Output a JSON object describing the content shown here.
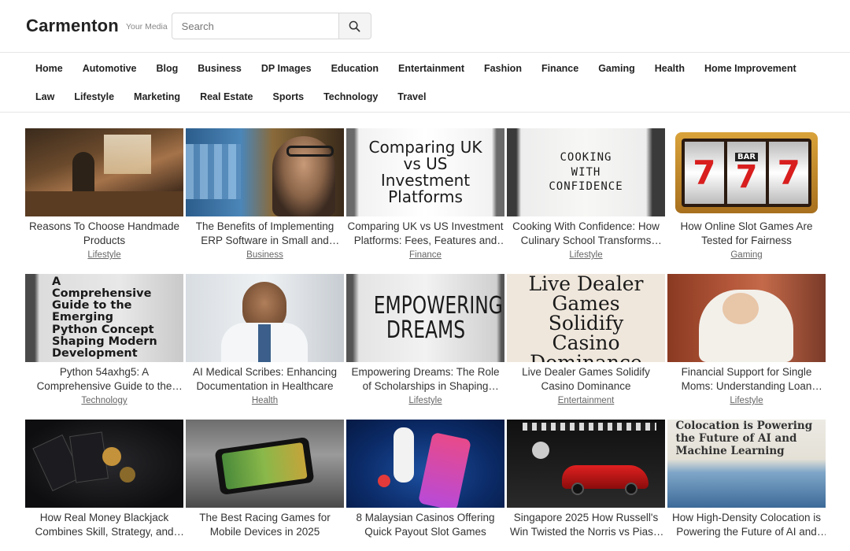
{
  "header": {
    "logo": "Carmenton",
    "tagline": "Your Media",
    "search_placeholder": "Search"
  },
  "nav": {
    "row1": [
      "Home",
      "Automotive",
      "Blog",
      "Business",
      "DP Images",
      "Education",
      "Entertainment",
      "Fashion",
      "Finance",
      "Gaming",
      "Health",
      "Home Improvement"
    ],
    "row2": [
      "Law",
      "Lifestyle",
      "Marketing",
      "Real Estate",
      "Sports",
      "Technology",
      "Travel"
    ]
  },
  "posts": [
    {
      "title": "Reasons To Choose Handmade Products",
      "category": "Lifestyle",
      "image": "workshop-photo"
    },
    {
      "title": "The Benefits of Implementing ERP Software in Small and Medium Businesses",
      "category": "Business",
      "image": "man-with-glasses-photo"
    },
    {
      "title": "Comparing UK vs US Investment Platforms: Fees, Features and More",
      "category": "Finance",
      "image": "sign-comparing-uk-us",
      "image_text": "Comparing UK vs US Investment Platforms"
    },
    {
      "title": "Cooking With Confidence: How Culinary School Transforms Home Cooks",
      "category": "Lifestyle",
      "image": "letterboard-cooking",
      "image_text": "COOKING WITH CONFIDENCE"
    },
    {
      "title": "How Online Slot Games Are Tested for Fairness",
      "category": "Gaming",
      "image": "slot-machine-777",
      "image_text": "BAR"
    },
    {
      "title": "Python 54axhg5: A Comprehensive Guide to the Emerging Python Concept",
      "category": "Technology",
      "image": "sign-python-guide",
      "image_text": "A Comprehensive Guide to the Emerging Python Concept Shaping Modern Development"
    },
    {
      "title": "AI Medical Scribes: Enhancing Documentation in Healthcare",
      "category": "Health",
      "image": "doctor-photo"
    },
    {
      "title": "Empowering Dreams: The Role of Scholarships in Shaping Futures",
      "category": "Lifestyle",
      "image": "sign-empowering-dreams",
      "image_text": "EMPOWERING DREAMS"
    },
    {
      "title": "Live Dealer Games Solidify Casino Dominance",
      "category": "Entertainment",
      "image": "sign-live-dealer",
      "image_text": "Live Dealer Games Solidify Casino Dominance"
    },
    {
      "title": "Financial Support for Single Moms: Understanding Loan Options",
      "category": "Lifestyle",
      "image": "mother-baby-photo"
    },
    {
      "title": "How Real Money Blackjack Combines Skill, Strategy, and Luck",
      "category": "",
      "image": "cards-chips-photo"
    },
    {
      "title": "The Best Racing Games for Mobile Devices in 2025",
      "category": "",
      "image": "mobile-racing-photo"
    },
    {
      "title": "8 Malaysian Casinos Offering Quick Payout Slot Games",
      "category": "",
      "image": "casino-phone-illustration"
    },
    {
      "title": "Singapore 2025 How Russell's Win Twisted the Norris vs Piastri Fight",
      "category": "",
      "image": "race-car-photo"
    },
    {
      "title": "How High-Density Colocation is Powering the Future of AI and Machine Learning",
      "category": "",
      "image": "sign-colocation",
      "image_text": "Colocation is Powering the Future of AI and Machine Learning"
    }
  ],
  "colors": {
    "accent": "#222222",
    "category_link": "#666666",
    "border": "#e6e6e6"
  }
}
